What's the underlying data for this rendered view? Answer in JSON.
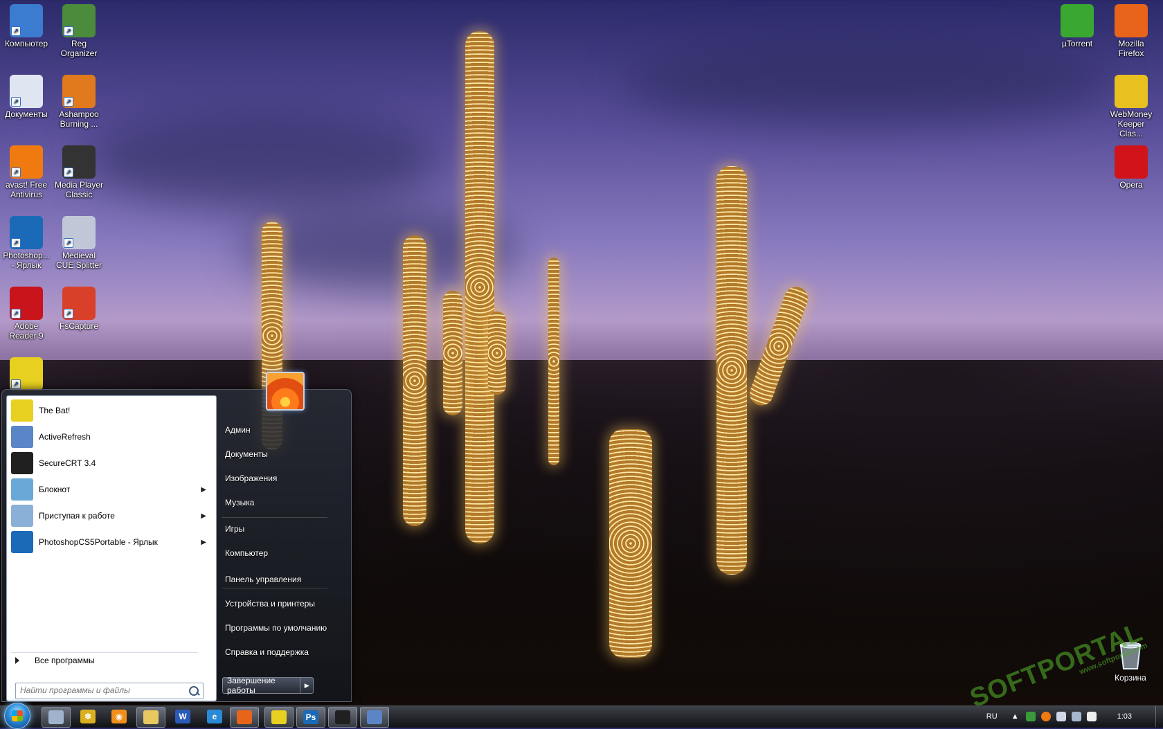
{
  "desktop_icons_left": [
    {
      "label": "Компьютер",
      "icon": "computer-icon",
      "color": "#3b7bd0"
    },
    {
      "label": "Reg\nOrganizer",
      "icon": "reg-organizer-icon",
      "color": "#4c8a3c"
    },
    {
      "label": "Документы",
      "icon": "documents-icon",
      "color": "#dfe6f2"
    },
    {
      "label": "Ashampoo\nBurning ...",
      "icon": "ashampoo-icon",
      "color": "#e07a1c"
    },
    {
      "label": "avast! Free\nAntivirus",
      "icon": "avast-icon",
      "color": "#f07a10"
    },
    {
      "label": "Media Player\nClassic",
      "icon": "mpc-icon",
      "color": "#333333"
    },
    {
      "label": "Photoshop...\n- Ярлык",
      "icon": "photoshop-icon",
      "color": "#1a6ab8"
    },
    {
      "label": "Medieval\nCUE Splitter",
      "icon": "cue-splitter-icon",
      "color": "#c0c8d8"
    },
    {
      "label": "Adobe\nReader 9",
      "icon": "adobe-reader-icon",
      "color": "#c8141a"
    },
    {
      "label": "FsCapture",
      "icon": "fscapture-icon",
      "color": "#d8402a"
    },
    {
      "label": "",
      "icon": "the-bat-icon",
      "color": "#e8d020"
    }
  ],
  "desktop_icons_right": [
    {
      "label": "µTorrent",
      "icon": "utorrent-icon",
      "color": "#3aa830"
    },
    {
      "label": "Mozilla\nFirefox",
      "icon": "firefox-icon",
      "color": "#e8641a"
    },
    {
      "label": "WebMoney\nKeeper Clas...",
      "icon": "webmoney-icon",
      "color": "#e8c020"
    },
    {
      "label": "Opera",
      "icon": "opera-icon",
      "color": "#d0141a"
    }
  ],
  "recycle_bin": {
    "label": "Корзина",
    "icon": "recycle-bin-icon"
  },
  "start_menu": {
    "programs": [
      {
        "label": "The Bat!",
        "icon": "the-bat-icon",
        "color": "#e8d020",
        "submenu": false
      },
      {
        "label": "ActiveRefresh",
        "icon": "activerefresh-icon",
        "color": "#5a86c8",
        "submenu": false
      },
      {
        "label": "SecureCRT 3.4",
        "icon": "securecrt-icon",
        "color": "#202020",
        "submenu": false
      },
      {
        "label": "Блокнот",
        "icon": "notepad-icon",
        "color": "#6aa8d8",
        "submenu": true
      },
      {
        "label": "Приступая к работе",
        "icon": "getting-started-icon",
        "color": "#8ab0d8",
        "submenu": true
      },
      {
        "label": "PhotoshopCS5Portable - Ярлык",
        "icon": "photoshop-icon",
        "color": "#1a6ab8",
        "submenu": true
      }
    ],
    "all_programs": "Все программы",
    "search_placeholder": "Найти программы и файлы",
    "right_items": [
      "Админ",
      "Документы",
      "Изображения",
      "Музыка",
      "Игры",
      "Компьютер",
      "Панель управления",
      "Устройства и принтеры",
      "Программы по умолчанию",
      "Справка и поддержка"
    ],
    "shutdown": "Завершение работы"
  },
  "taskbar": {
    "buttons": [
      {
        "icon": "show-desktop-icon",
        "color": "#9fb4cc",
        "glyph": "",
        "active": true
      },
      {
        "icon": "bug-app-icon",
        "color": "#d8b020",
        "glyph": "✽",
        "active": false
      },
      {
        "icon": "avast-tray-icon",
        "color": "#f0901a",
        "glyph": "◉",
        "active": false
      },
      {
        "icon": "explorer-icon",
        "color": "#e8c860",
        "glyph": "",
        "active": true
      },
      {
        "icon": "word-icon",
        "color": "#2a5ab8",
        "glyph": "W",
        "active": false
      },
      {
        "icon": "internet-explorer-icon",
        "color": "#2a8ad8",
        "glyph": "e",
        "active": false
      },
      {
        "icon": "firefox-icon",
        "color": "#e8641a",
        "glyph": "",
        "active": true
      },
      {
        "icon": "the-bat-icon",
        "color": "#e8d020",
        "glyph": "",
        "active": true
      },
      {
        "icon": "photoshop-icon",
        "color": "#1a6ab8",
        "glyph": "Ps",
        "active": true
      },
      {
        "icon": "securecrt-icon",
        "color": "#202020",
        "glyph": "",
        "active": true
      },
      {
        "icon": "remote-desktop-icon",
        "color": "#5a86c8",
        "glyph": "",
        "active": true
      }
    ],
    "language": "RU",
    "clock": "1:03"
  },
  "watermark": {
    "big": "SOFTPORTAL",
    "small": "www.softportal.com"
  },
  "colors": {
    "accent": "#2a8ad8",
    "menu_bg": "#1c1f26",
    "menu_left_bg": "#ffffff"
  }
}
